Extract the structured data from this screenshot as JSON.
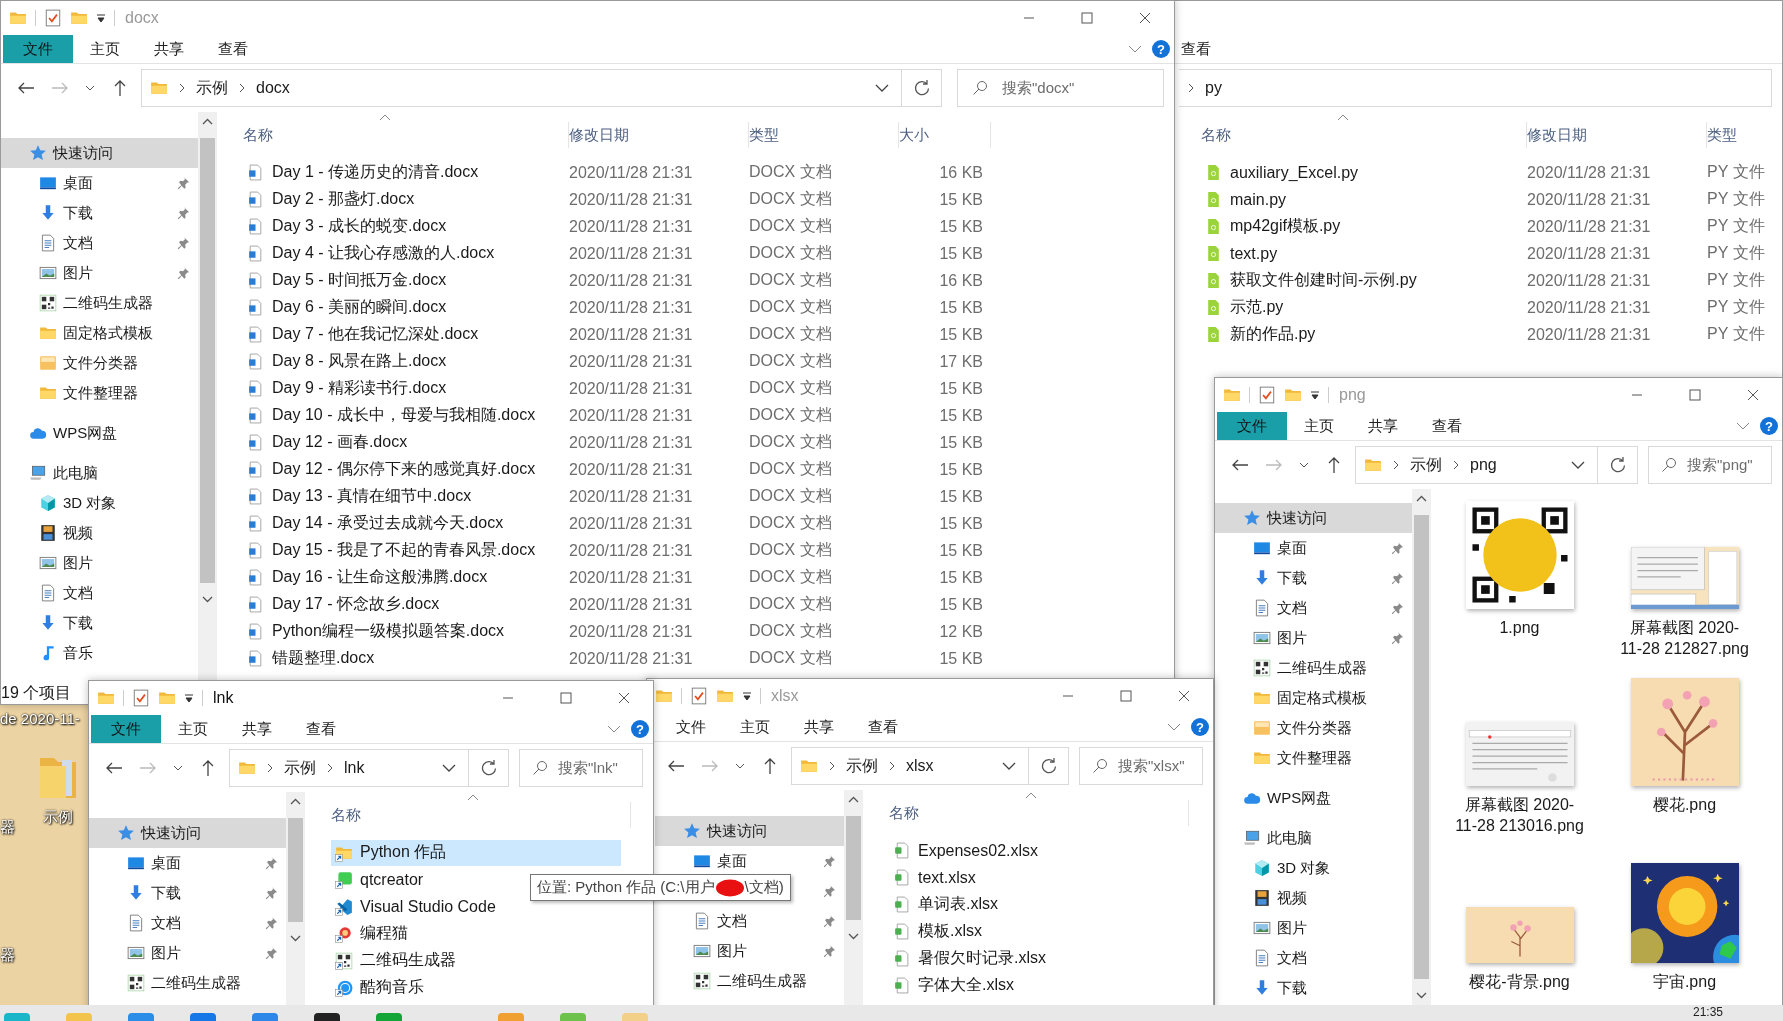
{
  "desktop": {
    "items": [
      {
        "label": "de 2020-11-",
        "kind": "text"
      },
      {
        "label": "器",
        "kind": "text"
      },
      {
        "label": "示例",
        "kind": "folder"
      },
      {
        "label": "器",
        "kind": "text"
      }
    ]
  },
  "windows": [
    {
      "title": "docx",
      "active": false,
      "help": "?",
      "ribbon_tabs": [
        {
          "label": "文件",
          "selected": true
        },
        {
          "label": "主页",
          "selected": false
        },
        {
          "label": "共享",
          "selected": false
        },
        {
          "label": "查看",
          "selected": false
        }
      ],
      "breadcrumb": [
        "示例",
        "docx"
      ],
      "search": {
        "placeholder": "搜索\"docx\""
      },
      "nav_pane": [
        {
          "label": "快速访问",
          "kind": "star",
          "selected": true,
          "pinned": false,
          "children": [
            {
              "label": "桌面",
              "kind": "desktop",
              "selected": false,
              "pinned": true
            },
            {
              "label": "下载",
              "kind": "download",
              "selected": false,
              "pinned": true
            },
            {
              "label": "文档",
              "kind": "doc",
              "selected": false,
              "pinned": true
            },
            {
              "label": "图片",
              "kind": "picture",
              "selected": false,
              "pinned": true
            },
            {
              "label": "二维码生成器",
              "kind": "qr",
              "selected": false,
              "pinned": false
            },
            {
              "label": "固定格式模板",
              "kind": "folder",
              "selected": false,
              "pinned": false
            },
            {
              "label": "文件分类器",
              "kind": "sorter",
              "selected": false,
              "pinned": false
            },
            {
              "label": "文件整理器",
              "kind": "folder",
              "selected": false,
              "pinned": false
            }
          ]
        },
        {
          "label": "WPS网盘",
          "kind": "cloud",
          "selected": false,
          "pinned": false
        },
        {
          "label": "此电脑",
          "kind": "pc",
          "selected": false,
          "pinned": false,
          "children": [
            {
              "label": "3D 对象",
              "kind": "cube",
              "selected": false,
              "pinned": false
            },
            {
              "label": "视频",
              "kind": "video",
              "selected": false,
              "pinned": false
            },
            {
              "label": "图片",
              "kind": "picture",
              "selected": false,
              "pinned": false
            },
            {
              "label": "文档",
              "kind": "doc",
              "selected": false,
              "pinned": false
            },
            {
              "label": "下载",
              "kind": "download",
              "selected": false,
              "pinned": false
            },
            {
              "label": "音乐",
              "kind": "music",
              "selected": false,
              "pinned": false
            }
          ]
        }
      ],
      "columns": [
        "名称",
        "修改日期",
        "类型",
        "大小"
      ],
      "rows": [
        {
          "name": "Day 1 - 传递历史的清音.docx",
          "date": "2020/11/28 21:31",
          "type": "DOCX 文档",
          "size": "16 KB",
          "kind": "word",
          "selected": false
        },
        {
          "name": "Day 2 - 那盏灯.docx",
          "date": "2020/11/28 21:31",
          "type": "DOCX 文档",
          "size": "15 KB",
          "kind": "word",
          "selected": false
        },
        {
          "name": "Day 3 - 成长的蜕变.docx",
          "date": "2020/11/28 21:31",
          "type": "DOCX 文档",
          "size": "15 KB",
          "kind": "word",
          "selected": false
        },
        {
          "name": "Day 4 - 让我心存感激的人.docx",
          "date": "2020/11/28 21:31",
          "type": "DOCX 文档",
          "size": "15 KB",
          "kind": "word",
          "selected": false
        },
        {
          "name": "Day 5 - 时间抵万金.docx",
          "date": "2020/11/28 21:31",
          "type": "DOCX 文档",
          "size": "16 KB",
          "kind": "word",
          "selected": false
        },
        {
          "name": "Day 6 - 美丽的瞬间.docx",
          "date": "2020/11/28 21:31",
          "type": "DOCX 文档",
          "size": "15 KB",
          "kind": "word",
          "selected": false
        },
        {
          "name": "Day 7 - 他在我记忆深处.docx",
          "date": "2020/11/28 21:31",
          "type": "DOCX 文档",
          "size": "15 KB",
          "kind": "word",
          "selected": false
        },
        {
          "name": "Day 8 - 风景在路上.docx",
          "date": "2020/11/28 21:31",
          "type": "DOCX 文档",
          "size": "17 KB",
          "kind": "word",
          "selected": false
        },
        {
          "name": "Day 9 - 精彩读书行.docx",
          "date": "2020/11/28 21:31",
          "type": "DOCX 文档",
          "size": "15 KB",
          "kind": "word",
          "selected": false
        },
        {
          "name": "Day 10 - 成长中，母爱与我相随.docx",
          "date": "2020/11/28 21:31",
          "type": "DOCX 文档",
          "size": "15 KB",
          "kind": "word",
          "selected": false
        },
        {
          "name": "Day 12 - 画春.docx",
          "date": "2020/11/28 21:31",
          "type": "DOCX 文档",
          "size": "15 KB",
          "kind": "word",
          "selected": false
        },
        {
          "name": "Day 12 - 偶尔停下来的感觉真好.docx",
          "date": "2020/11/28 21:31",
          "type": "DOCX 文档",
          "size": "15 KB",
          "kind": "word",
          "selected": false
        },
        {
          "name": "Day 13 - 真情在细节中.docx",
          "date": "2020/11/28 21:31",
          "type": "DOCX 文档",
          "size": "15 KB",
          "kind": "word",
          "selected": false
        },
        {
          "name": "Day 14 - 承受过去成就今天.docx",
          "date": "2020/11/28 21:31",
          "type": "DOCX 文档",
          "size": "15 KB",
          "kind": "word",
          "selected": false
        },
        {
          "name": "Day 15 - 我是了不起的青春风景.docx",
          "date": "2020/11/28 21:31",
          "type": "DOCX 文档",
          "size": "15 KB",
          "kind": "word",
          "selected": false
        },
        {
          "name": "Day 16 - 让生命这般沸腾.docx",
          "date": "2020/11/28 21:31",
          "type": "DOCX 文档",
          "size": "15 KB",
          "kind": "word",
          "selected": false
        },
        {
          "name": "Day 17 - 怀念故乡.docx",
          "date": "2020/11/28 21:31",
          "type": "DOCX 文档",
          "size": "15 KB",
          "kind": "word",
          "selected": false
        },
        {
          "name": "Python编程一级模拟题答案.docx",
          "date": "2020/11/28 21:31",
          "type": "DOCX 文档",
          "size": "12 KB",
          "kind": "word",
          "selected": false
        },
        {
          "name": "错题整理.docx",
          "date": "2020/11/28 21:31",
          "type": "DOCX 文档",
          "size": "15 KB",
          "kind": "word",
          "selected": false
        }
      ],
      "status_bar": "19 个项目"
    },
    {
      "ribbon_tabs": [
        {
          "label": "查看",
          "selected": false
        }
      ],
      "breadcrumb": [
        "py"
      ],
      "columns": [
        "名称",
        "修改日期",
        "类型"
      ],
      "rows": [
        {
          "name": "auxiliary_Excel.py",
          "date": "2020/11/28 21:31",
          "type": "PY 文件",
          "kind": "python",
          "selected": false
        },
        {
          "name": "main.py",
          "date": "2020/11/28 21:31",
          "type": "PY 文件",
          "kind": "python",
          "selected": false
        },
        {
          "name": "mp42gif模板.py",
          "date": "2020/11/28 21:31",
          "type": "PY 文件",
          "kind": "python",
          "selected": false
        },
        {
          "name": "text.py",
          "date": "2020/11/28 21:31",
          "type": "PY 文件",
          "kind": "python",
          "selected": false
        },
        {
          "name": "获取文件创建时间-示例.py",
          "date": "2020/11/28 21:31",
          "type": "PY 文件",
          "kind": "python",
          "selected": false
        },
        {
          "name": "示范.py",
          "date": "2020/11/28 21:31",
          "type": "PY 文件",
          "kind": "python",
          "selected": false
        },
        {
          "name": "新的作品.py",
          "date": "2020/11/28 21:31",
          "type": "PY 文件",
          "kind": "python",
          "selected": false
        }
      ]
    },
    {
      "title": "lnk",
      "active": true,
      "help": "?",
      "ribbon_tabs": [
        {
          "label": "文件",
          "selected": true
        },
        {
          "label": "主页",
          "selected": false
        },
        {
          "label": "共享",
          "selected": false
        },
        {
          "label": "查看",
          "selected": false
        }
      ],
      "breadcrumb": [
        "示例",
        "lnk"
      ],
      "search": {
        "placeholder": "搜索\"lnk\""
      },
      "nav_pane": [
        {
          "label": "快速访问",
          "kind": "star",
          "selected": true,
          "pinned": false,
          "children": [
            {
              "label": "桌面",
              "kind": "desktop",
              "selected": false,
              "pinned": true
            },
            {
              "label": "下载",
              "kind": "download",
              "selected": false,
              "pinned": true
            },
            {
              "label": "文档",
              "kind": "doc",
              "selected": false,
              "pinned": true
            },
            {
              "label": "图片",
              "kind": "picture",
              "selected": false,
              "pinned": true
            },
            {
              "label": "二维码生成器",
              "kind": "qr",
              "selected": false,
              "pinned": false
            }
          ]
        }
      ],
      "columns": [
        "名称"
      ],
      "rows": [
        {
          "name": "Python 作品",
          "kind": "folder-link",
          "selected": true
        },
        {
          "name": "qtcreator",
          "kind": "qt-link",
          "selected": false
        },
        {
          "name": "Visual Studio Code",
          "kind": "code-link",
          "selected": false
        },
        {
          "name": "编程猫",
          "kind": "cat-link",
          "selected": false
        },
        {
          "name": "二维码生成器",
          "kind": "qr-link",
          "selected": false
        },
        {
          "name": "酷狗音乐",
          "kind": "music-link",
          "selected": false
        }
      ]
    },
    {
      "title": "xlsx",
      "active": false,
      "help": "?",
      "ribbon_tabs": [
        {
          "label": "文件",
          "selected": false
        },
        {
          "label": "主页",
          "selected": false
        },
        {
          "label": "共享",
          "selected": false
        },
        {
          "label": "查看",
          "selected": false
        }
      ],
      "breadcrumb": [
        "示例",
        "xlsx"
      ],
      "search": {
        "placeholder": "搜索\"xlsx\""
      },
      "nav_pane": [
        {
          "label": "快速访问",
          "kind": "star",
          "selected": true,
          "pinned": false,
          "children": [
            {
              "label": "桌面",
              "kind": "desktop",
              "selected": false,
              "pinned": true
            },
            {
              "kind": "hidden",
              "selected": false,
              "pinned": true
            },
            {
              "label": "文档",
              "kind": "doc",
              "selected": false,
              "pinned": true
            },
            {
              "label": "图片",
              "kind": "picture",
              "selected": false,
              "pinned": true
            },
            {
              "label": "二维码生成器",
              "kind": "qr",
              "selected": false,
              "pinned": false
            }
          ]
        }
      ],
      "columns": [
        "名称"
      ],
      "rows": [
        {
          "name": "Expenses02.xlsx",
          "kind": "sheet",
          "selected": false
        },
        {
          "name": "text.xlsx",
          "kind": "sheet",
          "selected": false
        },
        {
          "name": "单词表.xlsx",
          "kind": "sheet",
          "selected": false
        },
        {
          "name": "模板.xlsx",
          "kind": "sheet",
          "selected": false
        },
        {
          "name": "暑假欠时记录.xlsx",
          "kind": "sheet",
          "selected": false
        },
        {
          "name": "字体大全.xlsx",
          "kind": "sheet",
          "selected": false
        }
      ]
    },
    {
      "title": "png",
      "active": false,
      "help": "?",
      "ribbon_tabs": [
        {
          "label": "文件",
          "selected": true
        },
        {
          "label": "主页",
          "selected": false
        },
        {
          "label": "共享",
          "selected": false
        },
        {
          "label": "查看",
          "selected": false
        }
      ],
      "breadcrumb": [
        "示例",
        "png"
      ],
      "search": {
        "placeholder": "搜索\"png\""
      },
      "nav_pane": [
        {
          "label": "快速访问",
          "kind": "star",
          "selected": true,
          "pinned": false,
          "children": [
            {
              "label": "桌面",
              "kind": "desktop",
              "selected": false,
              "pinned": true
            },
            {
              "label": "下载",
              "kind": "download",
              "selected": false,
              "pinned": true
            },
            {
              "label": "文档",
              "kind": "doc",
              "selected": false,
              "pinned": true
            },
            {
              "label": "图片",
              "kind": "picture",
              "selected": false,
              "pinned": true
            },
            {
              "label": "二维码生成器",
              "kind": "qr",
              "selected": false,
              "pinned": false
            },
            {
              "label": "固定格式模板",
              "kind": "folder",
              "selected": false,
              "pinned": false
            },
            {
              "label": "文件分类器",
              "kind": "sorter",
              "selected": false,
              "pinned": false
            },
            {
              "label": "文件整理器",
              "kind": "folder",
              "selected": false,
              "pinned": false
            }
          ]
        },
        {
          "label": "WPS网盘",
          "kind": "cloud",
          "selected": false,
          "pinned": false
        },
        {
          "label": "此电脑",
          "kind": "pc",
          "selected": false,
          "pinned": false,
          "children": [
            {
              "label": "3D 对象",
              "kind": "cube",
              "selected": false,
              "pinned": false
            },
            {
              "label": "视频",
              "kind": "video",
              "selected": false,
              "pinned": false
            },
            {
              "label": "图片",
              "kind": "picture",
              "selected": false,
              "pinned": false
            },
            {
              "label": "文档",
              "kind": "doc",
              "selected": false,
              "pinned": false
            },
            {
              "label": "下载",
              "kind": "download",
              "selected": false,
              "pinned": false
            }
          ]
        }
      ],
      "items": [
        {
          "name": "1.png",
          "selected": false
        },
        {
          "name": "屏幕截图 2020-11-28 212827.png",
          "selected": false
        },
        {
          "name": "屏幕截图 2020-11-28 213016.png",
          "selected": false
        },
        {
          "name": "樱花.png",
          "selected": false
        },
        {
          "name": "樱花-背景.png",
          "selected": false
        },
        {
          "name": "宇宙.png",
          "selected": false
        }
      ]
    }
  ],
  "tooltip": {
    "text_before_redaction": "位置: Python 作品 (C:\\用户",
    "text_after_redaction": "\\文档)"
  },
  "taskbar": {
    "clock": "21:35"
  }
}
